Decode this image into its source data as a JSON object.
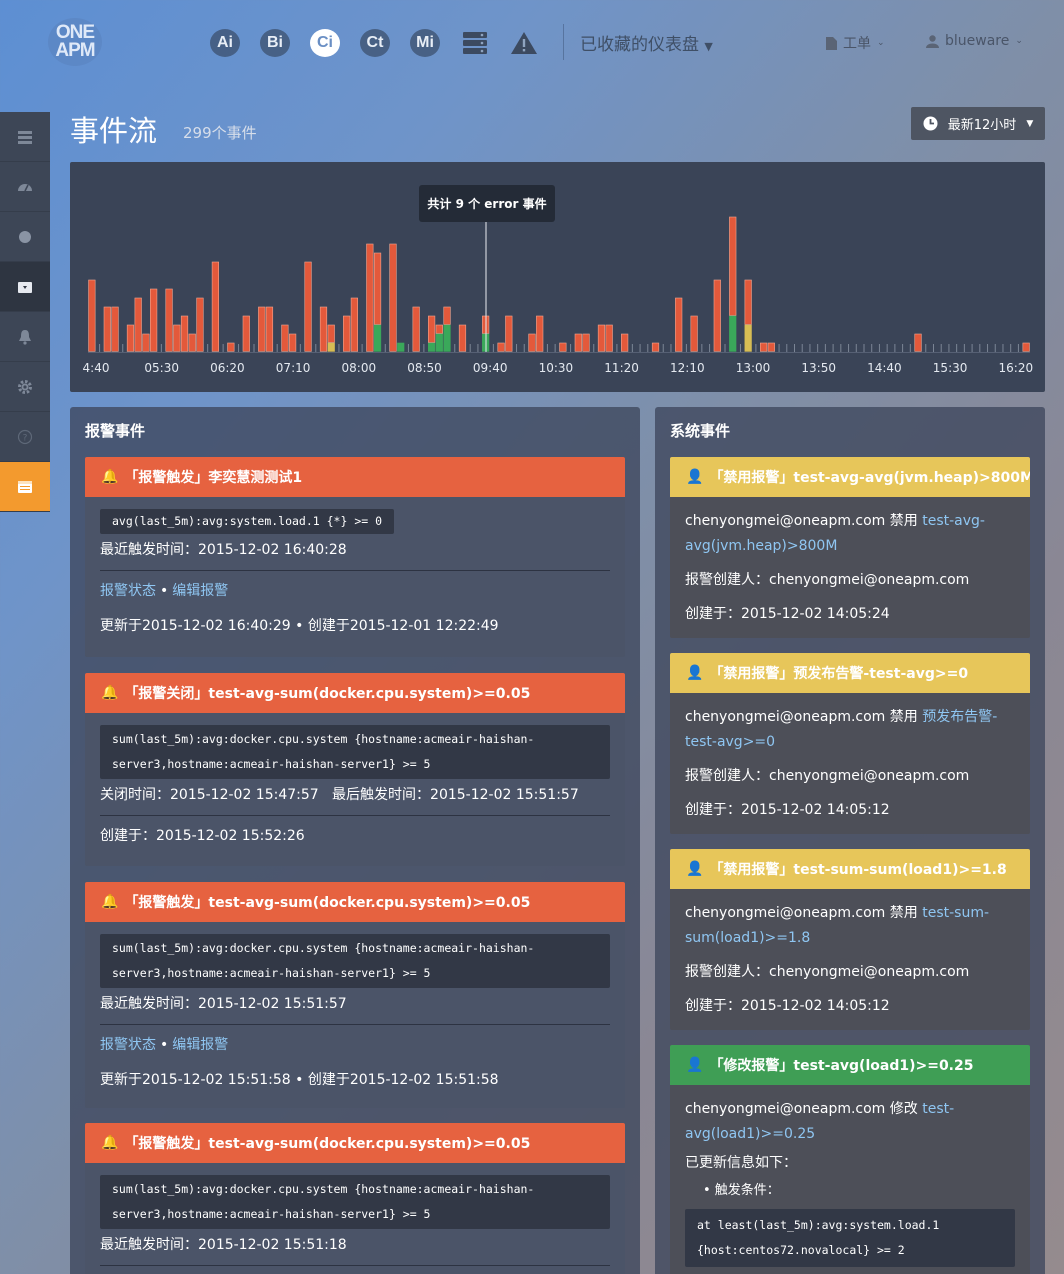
{
  "header": {
    "logo_top": "ONE",
    "logo_bottom": "APM",
    "products": [
      "Ai",
      "Bi",
      "Ci",
      "Ct",
      "Mi"
    ],
    "dashboard_menu": "已收藏的仪表盘",
    "ticket_menu": "工单",
    "user_menu": "blueware"
  },
  "sidebar": {
    "items": [
      "list-icon",
      "dashboard-icon",
      "circle-icon",
      "archive-icon",
      "bell-icon",
      "gear-icon",
      "help-icon",
      "calendar-icon"
    ],
    "active": "calendar-icon"
  },
  "page": {
    "title": "事件流",
    "event_count": "299个事件",
    "time_range": "最新12小时"
  },
  "chart_data": {
    "type": "bar",
    "x_ticks": [
      "4:40",
      "05:30",
      "06:20",
      "07:10",
      "08:00",
      "08:50",
      "09:40",
      "10:30",
      "11:20",
      "12:10",
      "13:00",
      "13:50",
      "14:40",
      "15:30",
      "16:20"
    ],
    "tooltip": "共计 9 个 error 事件",
    "colors": {
      "error": "#e3593b",
      "success": "#3aa85a",
      "warning": "#d7bd54",
      "tick": "#7b8595"
    },
    "series": [
      {
        "name": "error",
        "values": [
          8,
          0,
          5,
          5,
          0,
          3,
          6,
          2,
          7,
          0,
          7,
          3,
          4,
          2,
          6,
          0,
          10,
          0,
          1,
          0,
          4,
          0,
          5,
          5,
          0,
          3,
          2,
          0,
          10,
          0,
          5,
          2,
          0,
          4,
          6,
          0,
          12,
          8,
          0,
          12,
          0,
          0,
          5,
          0,
          3,
          1,
          2,
          0,
          3,
          0,
          0,
          2,
          0,
          1,
          4,
          0,
          0,
          2,
          4,
          0,
          0,
          1,
          0,
          2,
          2,
          0,
          3,
          3,
          0,
          2,
          0,
          0,
          0,
          1,
          0,
          0,
          6,
          0,
          4,
          0,
          0,
          8,
          0,
          11,
          0,
          5,
          0,
          1,
          1,
          0,
          0,
          0,
          0,
          0,
          0,
          0,
          0,
          0,
          0,
          0,
          0,
          0,
          0,
          0,
          0,
          0,
          0,
          2,
          0,
          0,
          0,
          0,
          0,
          0,
          0,
          0,
          0,
          0,
          0,
          0,
          0,
          1
        ]
      },
      {
        "name": "success",
        "values": [
          0,
          0,
          0,
          0,
          0,
          0,
          0,
          0,
          0,
          0,
          0,
          0,
          0,
          0,
          0,
          0,
          0,
          0,
          0,
          0,
          0,
          0,
          0,
          0,
          0,
          0,
          0,
          0,
          0,
          0,
          0,
          0,
          0,
          0,
          0,
          0,
          0,
          3,
          0,
          0,
          1,
          0,
          0,
          0,
          1,
          2,
          3,
          0,
          0,
          0,
          0,
          2,
          0,
          0,
          0,
          0,
          0,
          0,
          0,
          0,
          0,
          0,
          0,
          0,
          0,
          0,
          0,
          0,
          0,
          0,
          0,
          0,
          0,
          0,
          0,
          0,
          0,
          0,
          0,
          0,
          0,
          0,
          0,
          4,
          0,
          0,
          0,
          0,
          0,
          0,
          0,
          0,
          0,
          0,
          0,
          0,
          0,
          0,
          0,
          0,
          0,
          0,
          0,
          0,
          0,
          0,
          0,
          0,
          0,
          0,
          0,
          0,
          0,
          0,
          0,
          0,
          0,
          0,
          0,
          0,
          0,
          0
        ]
      },
      {
        "name": "warning",
        "values": [
          0,
          0,
          0,
          0,
          0,
          0,
          0,
          0,
          0,
          0,
          0,
          0,
          0,
          0,
          0,
          0,
          0,
          0,
          0,
          0,
          0,
          0,
          0,
          0,
          0,
          0,
          0,
          0,
          0,
          0,
          0,
          1,
          0,
          0,
          0,
          0,
          0,
          0,
          0,
          0,
          0,
          0,
          0,
          0,
          0,
          0,
          0,
          0,
          0,
          0,
          0,
          0,
          0,
          0,
          0,
          0,
          0,
          0,
          0,
          0,
          0,
          0,
          0,
          0,
          0,
          0,
          0,
          0,
          0,
          0,
          0,
          0,
          0,
          0,
          0,
          0,
          0,
          0,
          0,
          0,
          0,
          0,
          0,
          0,
          0,
          3,
          0,
          0,
          0,
          0,
          0,
          0,
          0,
          0,
          0,
          0,
          0,
          0,
          0,
          0,
          0,
          0,
          0,
          0,
          0,
          0,
          0,
          0,
          0,
          0,
          0,
          0,
          0,
          0,
          0,
          0,
          0,
          0,
          0,
          0,
          0,
          0
        ]
      }
    ]
  },
  "alerts": {
    "title": "报警事件",
    "items": [
      {
        "title": "「报警触发」李奕慧测测试1",
        "code": "avg(last_5m):avg:system.load.1 {*} >= 0",
        "time": "最近触发时间：2015-12-02 16:40:28",
        "links": [
          "报警状态",
          "编辑报警"
        ],
        "footer": "更新于2015-12-02 16:40:29 • 创建于2015-12-01 12:22:49"
      },
      {
        "title": "「报警关闭」test-avg-sum(docker.cpu.system)>=0.05",
        "code": "sum(last_5m):avg:docker.cpu.system {hostname:acmeair-haishan-server3,hostname:acmeair-haishan-server1} >= 5",
        "time": "关闭时间：2015-12-02 15:47:57   最后触发时间：2015-12-02 15:51:57",
        "footer": "创建于：2015-12-02 15:52:26"
      },
      {
        "title": "「报警触发」test-avg-sum(docker.cpu.system)>=0.05",
        "code": "sum(last_5m):avg:docker.cpu.system {hostname:acmeair-haishan-server3,hostname:acmeair-haishan-server1} >= 5",
        "time": "最近触发时间：2015-12-02 15:51:57",
        "links": [
          "报警状态",
          "编辑报警"
        ],
        "footer": "更新于2015-12-02 15:51:58 • 创建于2015-12-02 15:51:58"
      },
      {
        "title": "「报警触发」test-avg-sum(docker.cpu.system)>=0.05",
        "code": "sum(last_5m):avg:docker.cpu.system {hostname:acmeair-haishan-server3,hostname:acmeair-haishan-server1} >= 5",
        "time": "最近触发时间：2015-12-02 15:51:18"
      }
    ]
  },
  "system": {
    "title": "系统事件",
    "items": [
      {
        "title": "「禁用报警」test-avg-avg(jvm.heap)>800M",
        "action": "chenyongmei@oneapm.com 禁用 ",
        "link": "test-avg-avg(jvm.heap)>800M",
        "creator": "报警创建人：chenyongmei@oneapm.com",
        "created": "创建于：2015-12-02 14:05:24"
      },
      {
        "title": "「禁用报警」预发布告警-test-avg>=0",
        "action": "chenyongmei@oneapm.com 禁用 ",
        "link": "预发布告警-test-avg>=0",
        "creator": "报警创建人：chenyongmei@oneapm.com",
        "created": "创建于：2015-12-02 14:05:12"
      },
      {
        "title": "「禁用报警」test-sum-sum(load1)>=1.8",
        "action": "chenyongmei@oneapm.com 禁用 ",
        "link": "test-sum-sum(load1)>=1.8",
        "creator": "报警创建人：chenyongmei@oneapm.com",
        "created": "创建于：2015-12-02 14:05:12"
      },
      {
        "title": "「修改报警」test-avg(load1)>=0.25",
        "action": "chenyongmei@oneapm.com 修改 ",
        "link": "test-avg(load1)>=0.25",
        "update_note": "已更新信息如下：",
        "bullet": "• 触发条件：",
        "code": "at least(last_5m):avg:system.load.1 {host:centos72.novalocal} >= 2"
      }
    ]
  }
}
